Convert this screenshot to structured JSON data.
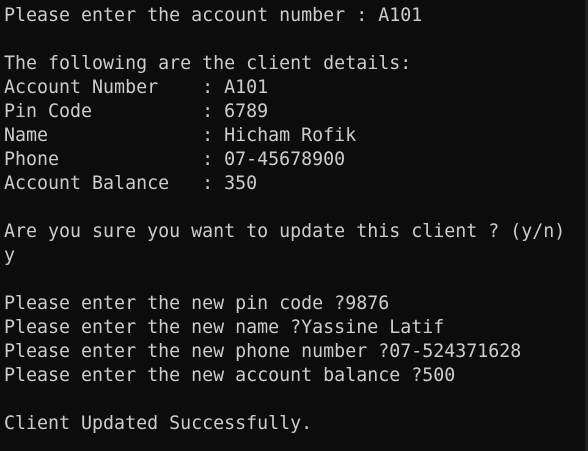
{
  "theme": {
    "background": "#0c0c0c",
    "foreground": "#cccccc"
  },
  "console": {
    "lines": [
      "Please enter the account number : A101",
      "",
      "The following are the client details:",
      "Account Number    : A101",
      "Pin Code          : 6789",
      "Name              : Hicham Rofik",
      "Phone             : 07-45678900",
      "Account Balance   : 350",
      "",
      "Are you sure you want to update this client ? (y/n)",
      "y",
      "",
      "Please enter the new pin code ?9876",
      "Please enter the new name ?Yassine Latif",
      "Please enter the new phone number ?07-524371628",
      "Please enter the new account balance ?500",
      "",
      "Client Updated Successfully."
    ]
  }
}
